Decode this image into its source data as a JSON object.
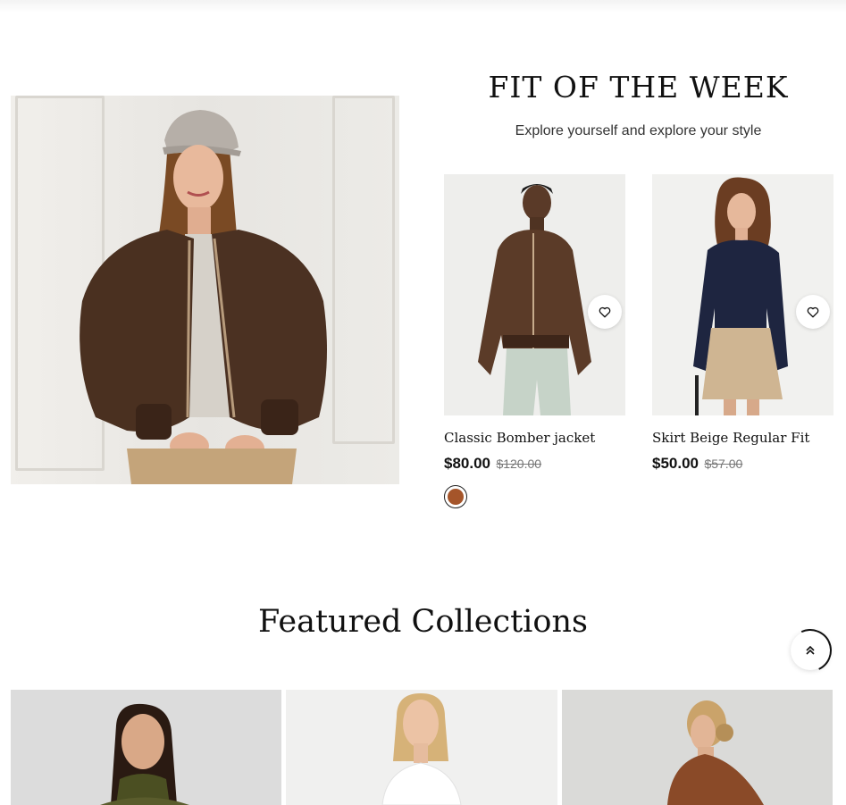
{
  "fit_section": {
    "title": "FIT OF THE WEEK",
    "subtitle": "Explore yourself and explore your style"
  },
  "products": [
    {
      "name": "Classic Bomber jacket",
      "price": "$80.00",
      "old_price": "$120.00",
      "swatch_color": "#a5552a",
      "wishlist_icon": "heart-icon"
    },
    {
      "name": "Skirt Beige Regular Fit",
      "price": "$50.00",
      "old_price": "$57.00",
      "wishlist_icon": "heart-icon"
    }
  ],
  "featured": {
    "title": "Featured Collections"
  },
  "scroll_top_icon": "double-chevron-up-icon",
  "colors": {
    "swatch_brown": "#a5552a",
    "text": "#111111"
  }
}
